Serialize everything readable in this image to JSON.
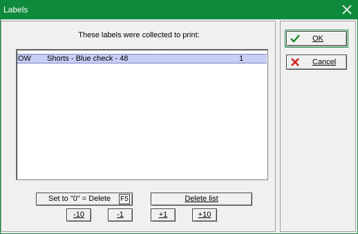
{
  "window": {
    "title": "Labels"
  },
  "heading": "These labels were collected to print:",
  "list": {
    "rows": [
      {
        "code": "OW",
        "description": "Shorts - Blue check - 48",
        "quantity": "1"
      }
    ]
  },
  "buttons": {
    "set_zero_delete": "Set to \"0\" = Delete",
    "set_zero_delete_key": "F5",
    "delete_list": "Delete list",
    "minus_10": "-10",
    "minus_1": "-1",
    "plus_1": "+1",
    "plus_10": "+10",
    "ok": "OK",
    "cancel": "Cancel"
  },
  "icons": {
    "ok": "checkmark-icon",
    "cancel": "x-icon",
    "close": "close-icon"
  },
  "colors": {
    "titlebar": "#0f8a3c",
    "selected_row": "#c8cdf5",
    "ok_check": "#1a8a2a",
    "cancel_x": "#d02020"
  }
}
